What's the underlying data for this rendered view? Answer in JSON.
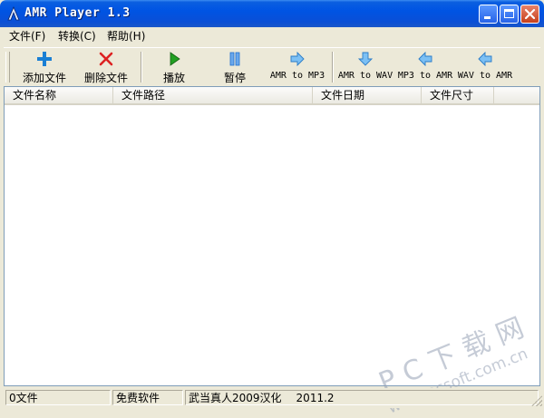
{
  "window": {
    "title": "AMR Player 1.3",
    "icon": "amr-player-icon"
  },
  "menu": [
    {
      "label": "文件(F)"
    },
    {
      "label": "转换(C)"
    },
    {
      "label": "帮助(H)"
    }
  ],
  "toolbar": {
    "add": {
      "label": "添加文件",
      "icon": "add-icon",
      "color": "#1a7fd4"
    },
    "remove": {
      "label": "删除文件",
      "icon": "delete-icon",
      "color": "#d22"
    },
    "play": {
      "label": "播放",
      "icon": "play-icon",
      "color": "#22a022"
    },
    "pause": {
      "label": "暂停",
      "icon": "pause-icon",
      "color": "#1e6fd0"
    },
    "amr_to_mp3": {
      "label": "AMR to MP3",
      "icon": "arrow-right-icon"
    },
    "amr_to_wav": {
      "label": "AMR to WAV",
      "icon": "arrow-down-icon"
    },
    "mp3_to_amr": {
      "label": "MP3 to AMR",
      "icon": "arrow-left-icon"
    },
    "wav_to_amr": {
      "label": "WAV to AMR",
      "icon": "arrow-left-icon"
    }
  },
  "list": {
    "columns": [
      "文件名称",
      "文件路径",
      "文件日期",
      "文件尺寸"
    ],
    "rows": []
  },
  "status": {
    "file_count": "0文件",
    "license": "免费软件",
    "translator": "武当真人2009汉化",
    "version_date": "2011.2"
  },
  "watermark": {
    "logo": "PC下载网",
    "url": "www.pcsoft.com.cn"
  },
  "colors": {
    "titlebar": "#0054e3",
    "face": "#ece9d8",
    "arrow": "#3ea0e8"
  }
}
